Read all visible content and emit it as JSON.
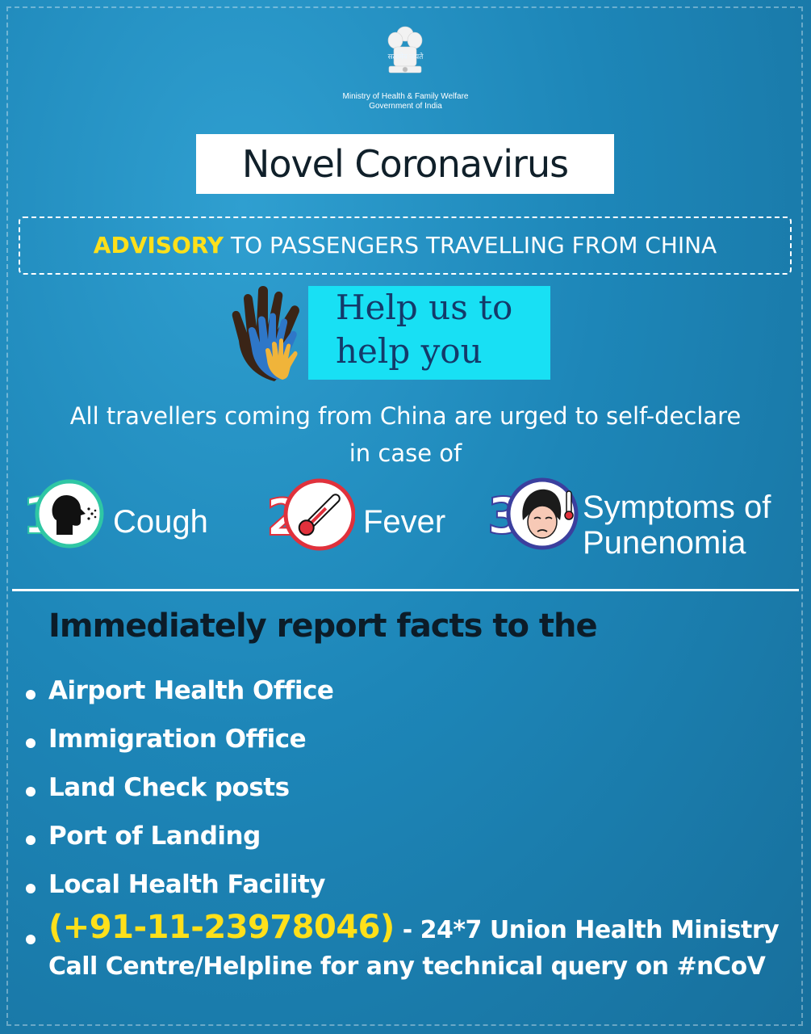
{
  "header": {
    "emblem_motto": "सत्यमेव जयते",
    "ministry_line1": "Ministry of Health & Family Welfare",
    "ministry_line2": "Government of India"
  },
  "title": "Novel Coronavirus",
  "advisory": {
    "highlight": "ADVISORY",
    "rest": " TO PASSENGERS TRAVELLING FROM CHINA"
  },
  "help": {
    "line1": "Help us to",
    "line2": "help you"
  },
  "intro": {
    "line1": "All travellers coming from China are urged to self-declare",
    "line2": "in case of"
  },
  "symptoms": [
    {
      "number": "1",
      "label": "Cough",
      "icon": "cough-icon"
    },
    {
      "number": "2",
      "label": "Fever",
      "icon": "thermometer-icon"
    },
    {
      "number": "3",
      "label_line1": "Symptoms of",
      "label_line2": "Punenomia",
      "icon": "sick-face-icon"
    }
  ],
  "report": {
    "heading": "Immediately report facts to the",
    "items": [
      "Airport Health Office",
      "Immigration Office",
      "Land Check posts",
      "Port of Landing",
      "Local Health Facility"
    ],
    "helpline_phone": "(+91-11-23978046)",
    "helpline_rest": " - 24*7 Union Health Ministry",
    "helpline_line2": "Call Centre/Helpline for any technical query on #nCoV"
  },
  "colors": {
    "background": "#1d86b8",
    "highlight_yellow": "#ffe01a",
    "help_band": "#18e0f4",
    "cough_ring": "#2fc7a4",
    "fever_ring": "#e0313c",
    "pneumonia_ring": "#3b3f9e"
  }
}
